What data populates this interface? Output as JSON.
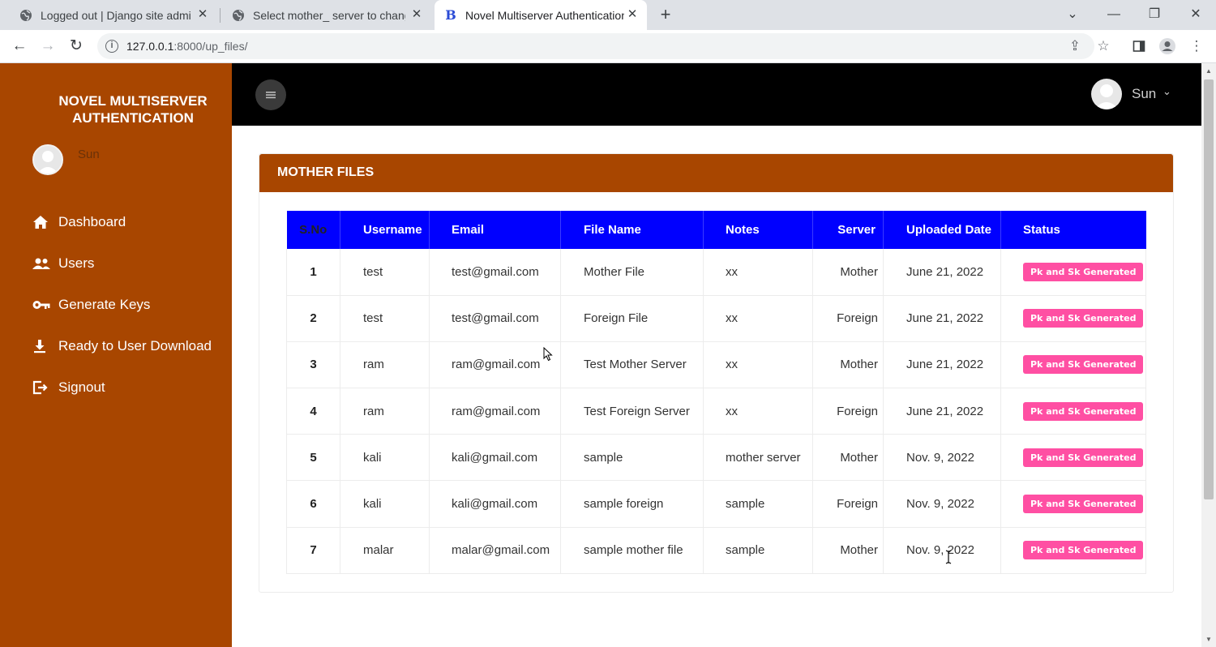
{
  "browser": {
    "tabs": [
      {
        "title": "Logged out | Django site admin",
        "icon": "globe-icon"
      },
      {
        "title": "Select mother_ server to change",
        "icon": "globe-icon"
      },
      {
        "title": "Novel Multiserver Authentication",
        "icon": "b-logo-icon",
        "favicon_letter": "B",
        "active": true
      }
    ],
    "url_host": "127.0.0.1",
    "url_path": ":8000/up_files/"
  },
  "sidebar": {
    "brand": "NOVEL MULTISERVER AUTHENTICATION",
    "username": "Sun",
    "items": [
      {
        "label": "Dashboard",
        "icon": "home-icon"
      },
      {
        "label": "Users",
        "icon": "users-icon"
      },
      {
        "label": "Generate Keys",
        "icon": "key-icon"
      },
      {
        "label": "Ready to User Download",
        "icon": "download-icon"
      },
      {
        "label": "Signout",
        "icon": "signout-icon"
      }
    ]
  },
  "header": {
    "username": "Sun"
  },
  "card": {
    "title": "MOTHER FILES"
  },
  "table": {
    "columns": [
      "S.No",
      "Username",
      "Email",
      "File Name",
      "Notes",
      "Server",
      "Uploaded Date",
      "Status"
    ],
    "rows": [
      [
        "1",
        "test",
        "test@gmail.com",
        "Mother File",
        "xx",
        "Mother",
        "June 21, 2022",
        "Pk and Sk Generated"
      ],
      [
        "2",
        "test",
        "test@gmail.com",
        "Foreign File",
        "xx",
        "Foreign",
        "June 21, 2022",
        "Pk and Sk Generated"
      ],
      [
        "3",
        "ram",
        "ram@gmail.com",
        "Test Mother Server",
        "xx",
        "Mother",
        "June 21, 2022",
        "Pk and Sk Generated"
      ],
      [
        "4",
        "ram",
        "ram@gmail.com",
        "Test Foreign Server",
        "xx",
        "Foreign",
        "June 21, 2022",
        "Pk and Sk Generated"
      ],
      [
        "5",
        "kali",
        "kali@gmail.com",
        "sample",
        "mother server",
        "Mother",
        "Nov. 9, 2022",
        "Pk and Sk Generated"
      ],
      [
        "6",
        "kali",
        "kali@gmail.com",
        "sample foreign",
        "sample",
        "Foreign",
        "Nov. 9, 2022",
        "Pk and Sk Generated"
      ],
      [
        "7",
        "malar",
        "malar@gmail.com",
        "sample mother file",
        "sample",
        "Mother",
        "Nov. 9, 2022",
        "Pk and Sk Generated"
      ]
    ]
  },
  "colors": {
    "brand": "#a84600",
    "table_header": "#0000ff",
    "badge": "#ff4fa3"
  }
}
